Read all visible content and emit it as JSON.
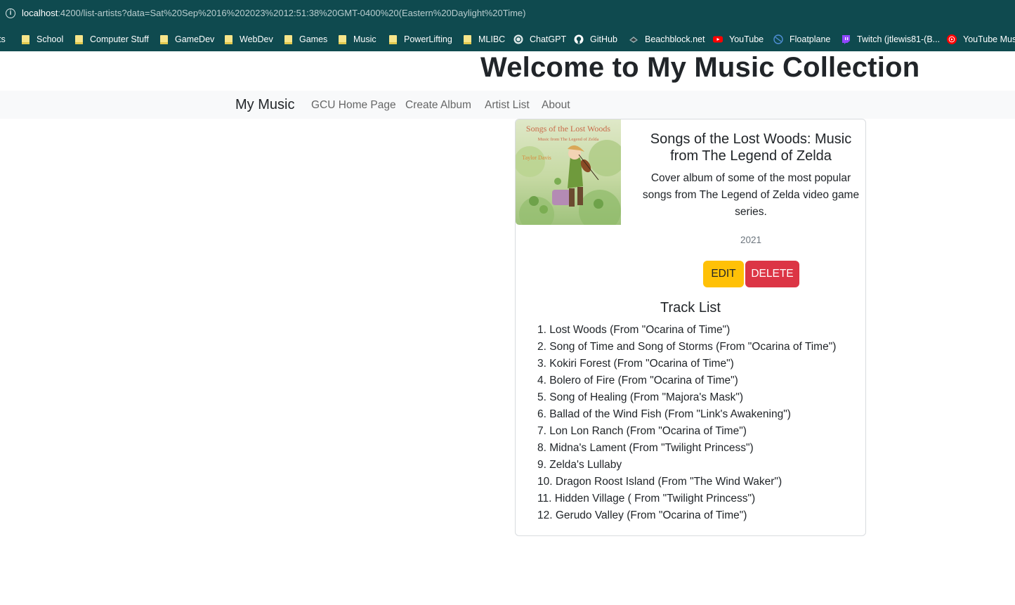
{
  "browser": {
    "url_host": "localhost",
    "url_rest": ":4200/list-artists?data=Sat%20Sep%2016%202023%2012:51:38%20GMT-0400%20(Eastern%20Daylight%20Time)",
    "bookmarks": [
      {
        "label": "ts",
        "icon": "none"
      },
      {
        "label": "School",
        "icon": "folder-icon"
      },
      {
        "label": "Computer Stuff",
        "icon": "folder-icon"
      },
      {
        "label": "GameDev",
        "icon": "folder-icon"
      },
      {
        "label": "WebDev",
        "icon": "folder-icon"
      },
      {
        "label": "Games",
        "icon": "folder-icon"
      },
      {
        "label": "Music",
        "icon": "folder-icon"
      },
      {
        "label": "PowerLifting",
        "icon": "folder-icon"
      },
      {
        "label": "MLIBC",
        "icon": "folder-icon"
      },
      {
        "label": "ChatGPT",
        "icon": "chatgpt-icon"
      },
      {
        "label": "GitHub",
        "icon": "github-icon"
      },
      {
        "label": "Beachblock.net",
        "icon": "beachblock-icon"
      },
      {
        "label": "YouTube",
        "icon": "youtube-icon"
      },
      {
        "label": "Floatplane",
        "icon": "floatplane-icon"
      },
      {
        "label": "Twitch (jtlewis81-(B...",
        "icon": "twitch-icon"
      },
      {
        "label": "YouTube Music",
        "icon": "youtube-music-icon"
      }
    ]
  },
  "header": {
    "title": "Welcome to My Music Collection"
  },
  "nav": {
    "brand": "My Music",
    "links": [
      "GCU Home Page",
      "Create Album",
      "Artist List",
      "About"
    ]
  },
  "album": {
    "cover_title": "Songs of the Lost Woods",
    "cover_subtitle": "Music from The Legend of Zelda",
    "cover_artist": "Taylor Davis",
    "title": "Songs of the Lost Woods: Music from The Legend of Zelda",
    "description": "Cover album of some of the most popular songs from The Legend of Zelda video game series.",
    "year": "2021",
    "edit_label": "EDIT",
    "delete_label": "DELETE",
    "track_list_title": "Track List",
    "tracks": [
      "1. Lost Woods (From \"Ocarina of Time\")",
      "2. Song of Time and Song of Storms (From \"Ocarina of Time\")",
      "3. Kokiri Forest (From \"Ocarina of Time\")",
      "4. Bolero of Fire (From \"Ocarina of Time\")",
      "5. Song of Healing (From \"Majora's Mask\")",
      "6. Ballad of the Wind Fish (From \"Link's Awakening\")",
      "7. Lon Lon Ranch (From \"Ocarina of Time\")",
      "8. Midna's Lament (From \"Twilight Princess\")",
      "9. Zelda's Lullaby",
      "10. Dragon Roost Island (From \"The Wind Waker\")",
      "11. Hidden Village ( From \"Twilight Princess\")",
      "12. Gerudo Valley (From \"Ocarina of Time\")"
    ]
  },
  "colors": {
    "chrome": "#0f4a4f",
    "navbar": "#f8f9fa",
    "edit": "#ffc107",
    "delete": "#dc3545"
  }
}
